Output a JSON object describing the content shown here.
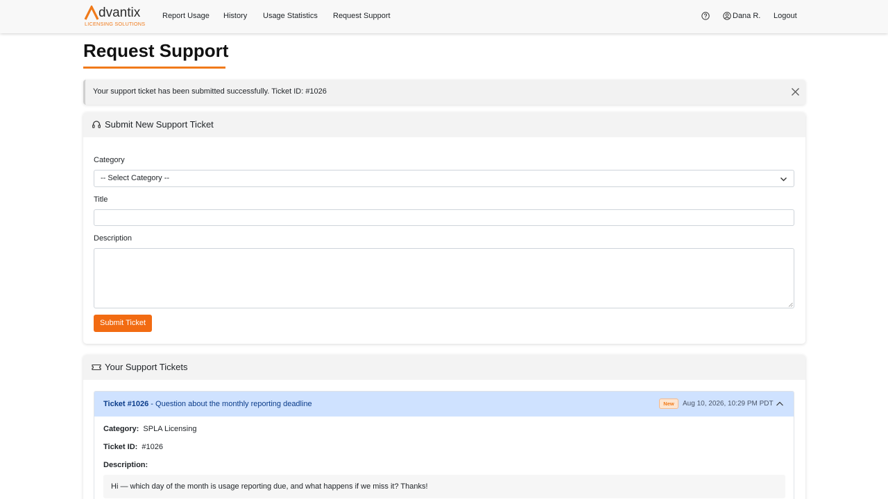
{
  "brand": {
    "name": "dvantix",
    "tagline": "LICENSING SOLUTIONS",
    "accent_color": "#f07a1a"
  },
  "nav": {
    "links": [
      "Report Usage",
      "History",
      "Usage Statistics",
      "Request Support"
    ],
    "user_name": "Dana R.",
    "logout": "Logout"
  },
  "page": {
    "title": "Request Support"
  },
  "alert": {
    "message": "Your support ticket has been submitted successfully. Ticket ID: #1026"
  },
  "form": {
    "header": "Submit New Support Ticket",
    "category_label": "Category",
    "category_selected": "-- Select Category --",
    "title_label": "Title",
    "title_value": "",
    "description_label": "Description",
    "description_value": "",
    "submit_label": "Submit Ticket",
    "button_color": "#f26b12"
  },
  "tickets": {
    "header": "Your Support Tickets",
    "items": [
      {
        "number": "Ticket #1026",
        "subject": " - Question about the monthly reporting deadline",
        "status": "New",
        "date": "Aug 10, 2026, 10:29 PM PDT",
        "category_label": "Category:",
        "category": "SPLA Licensing",
        "id_label": "Ticket ID:",
        "id": "#1026",
        "description_label": "Description:",
        "description": "Hi — which day of the month is usage reporting due, and what happens if we miss it? Thanks!"
      }
    ]
  }
}
